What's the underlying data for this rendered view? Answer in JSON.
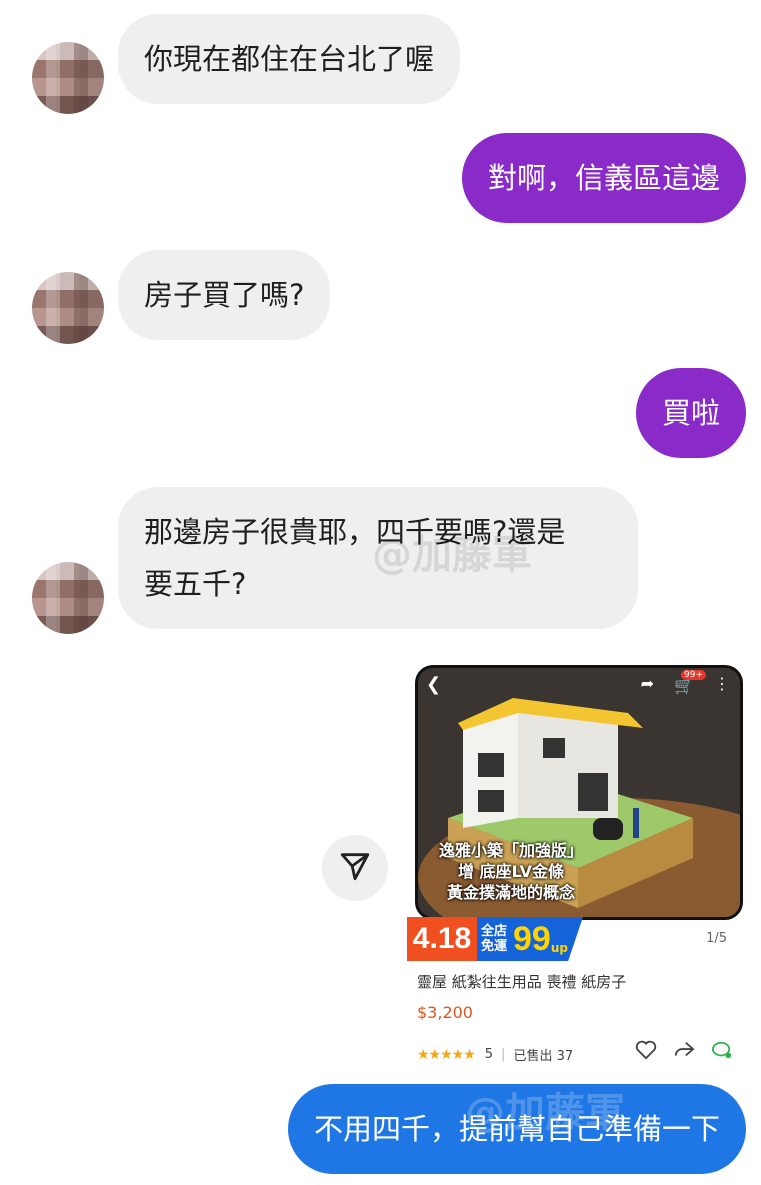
{
  "messages": {
    "m1": "你現在都住在台北了喔",
    "m2": "對啊，信義區這邊",
    "m3": "房子買了嗎?",
    "m4": "買啦",
    "m5_line1": "那邊房子很貴耶，四千要嗎?還是",
    "m5_line2": "要五千?",
    "m6": "不用四千，提前幫自己準備一下"
  },
  "product": {
    "overlay_line1": "逸雅小築「加強版」",
    "overlay_line2": "增 底座LV金條",
    "overlay_line3": "黃金撲滿地的概念",
    "cart_badge": "99+",
    "sale_left": "4.18",
    "sale_small_1": "全店",
    "sale_small_2": "免運",
    "sale_big": "99",
    "sale_up": "up",
    "pager": "1/5",
    "title": "靈屋 紙紮往生用品 喪禮 紙房子",
    "price": "$3,200",
    "rating": "5",
    "sold": "已售出 37"
  },
  "watermarks": {
    "w1": "@加藤軍",
    "w2": "@加藤軍"
  },
  "colors": {
    "purple": "#8a2ac9",
    "blue": "#1f76e5",
    "incoming": "#efefef",
    "price": "#e0561f"
  }
}
